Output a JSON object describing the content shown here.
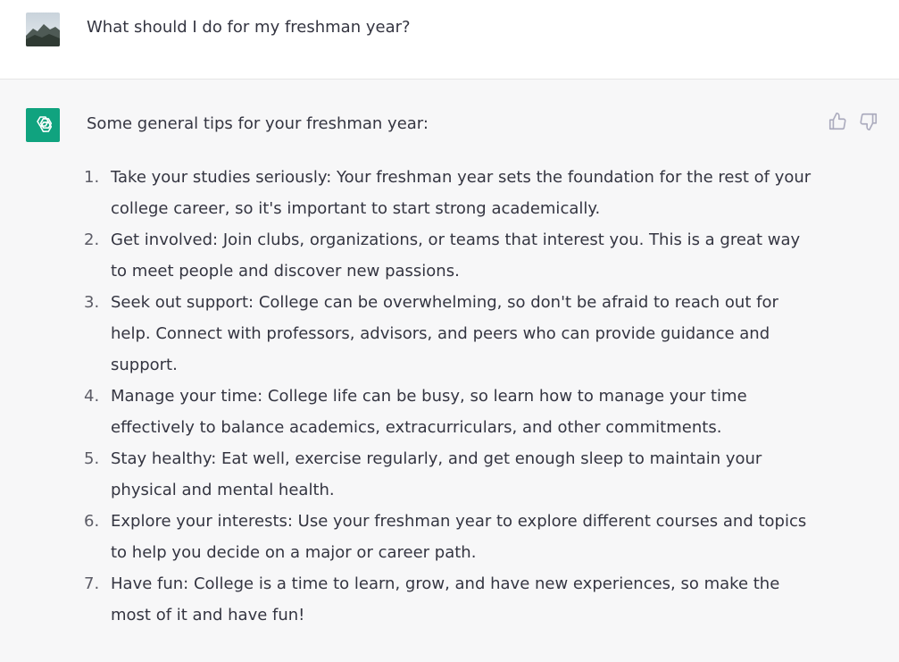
{
  "user_message": {
    "text": "What should I do for my freshman year?"
  },
  "assistant_message": {
    "intro": "Some general tips for your freshman year:",
    "tips": [
      {
        "number": "1.",
        "text": "Take your studies seriously: Your freshman year sets the foundation for the rest of your college career, so it's important to start strong academically."
      },
      {
        "number": "2.",
        "text": "Get involved: Join clubs, organizations, or teams that interest you. This is a great way to meet people and discover new passions."
      },
      {
        "number": "3.",
        "text": "Seek out support: College can be overwhelming, so don't be afraid to reach out for help. Connect with professors, advisors, and peers who can provide guidance and support."
      },
      {
        "number": "4.",
        "text": "Manage your time: College life can be busy, so learn how to manage your time effectively to balance academics, extracurriculars, and other commitments."
      },
      {
        "number": "5.",
        "text": "Stay healthy: Eat well, exercise regularly, and get enough sleep to maintain your physical and mental health."
      },
      {
        "number": "6.",
        "text": "Explore your interests: Use your freshman year to explore different courses and topics to help you decide on a major or career path."
      },
      {
        "number": "7.",
        "text": "Have fun: College is a time to learn, grow, and have new experiences, so make the most of it and have fun!"
      }
    ],
    "feedback_icons": [
      "thumbs-up-icon",
      "thumbs-down-icon"
    ]
  },
  "colors": {
    "assistant_bg": "#f7f7f8",
    "user_bg": "#ffffff",
    "brand_green": "#10a37f",
    "text": "#343541",
    "icon": "#acacbe"
  }
}
